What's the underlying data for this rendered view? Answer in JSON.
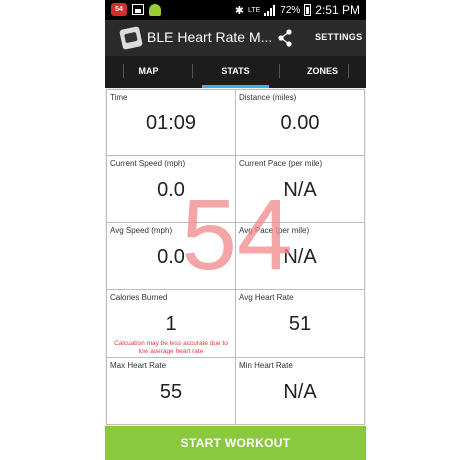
{
  "status_bar": {
    "lte": "LTE",
    "battery_pct": "72%",
    "time": "2:51 PM",
    "heart_badge": "54"
  },
  "action_bar": {
    "title": "BLE Heart Rate M...",
    "settings_label": "SETTINGS"
  },
  "tabs": [
    {
      "label": "MAP",
      "active": false
    },
    {
      "label": "STATS",
      "active": true
    },
    {
      "label": "ZONES",
      "active": false
    }
  ],
  "stats": {
    "time": {
      "label": "Time",
      "value": "01:09"
    },
    "distance": {
      "label": "Distance (miles)",
      "value": "0.00"
    },
    "current_speed": {
      "label": "Current Speed (mph)",
      "value": "0.0"
    },
    "current_pace": {
      "label": "Current Pace (per mile)",
      "value": "N/A"
    },
    "avg_speed": {
      "label": "Avg Speed (mph)",
      "value": "0.0"
    },
    "avg_pace": {
      "label": "Avg Pace (per mile)",
      "value": "N/A"
    },
    "calories": {
      "label": "Calories Burned",
      "value": "1",
      "note_line1": "Calcuation may be less accurate due to",
      "note_line2": "low average heart rate"
    },
    "avg_hr": {
      "label": "Avg Heart Rate",
      "value": "51"
    },
    "max_hr": {
      "label": "Max Heart Rate",
      "value": "55"
    },
    "min_hr": {
      "label": "Min Heart Rate",
      "value": "N/A"
    }
  },
  "current_heart_rate": "54",
  "start_button_label": "START WORKOUT",
  "colors": {
    "tab_indicator": "#35b5e5",
    "start_button": "#8ac93f",
    "heart_rate_overlay": "#f28c8c",
    "note_text": "#e23b3b"
  }
}
